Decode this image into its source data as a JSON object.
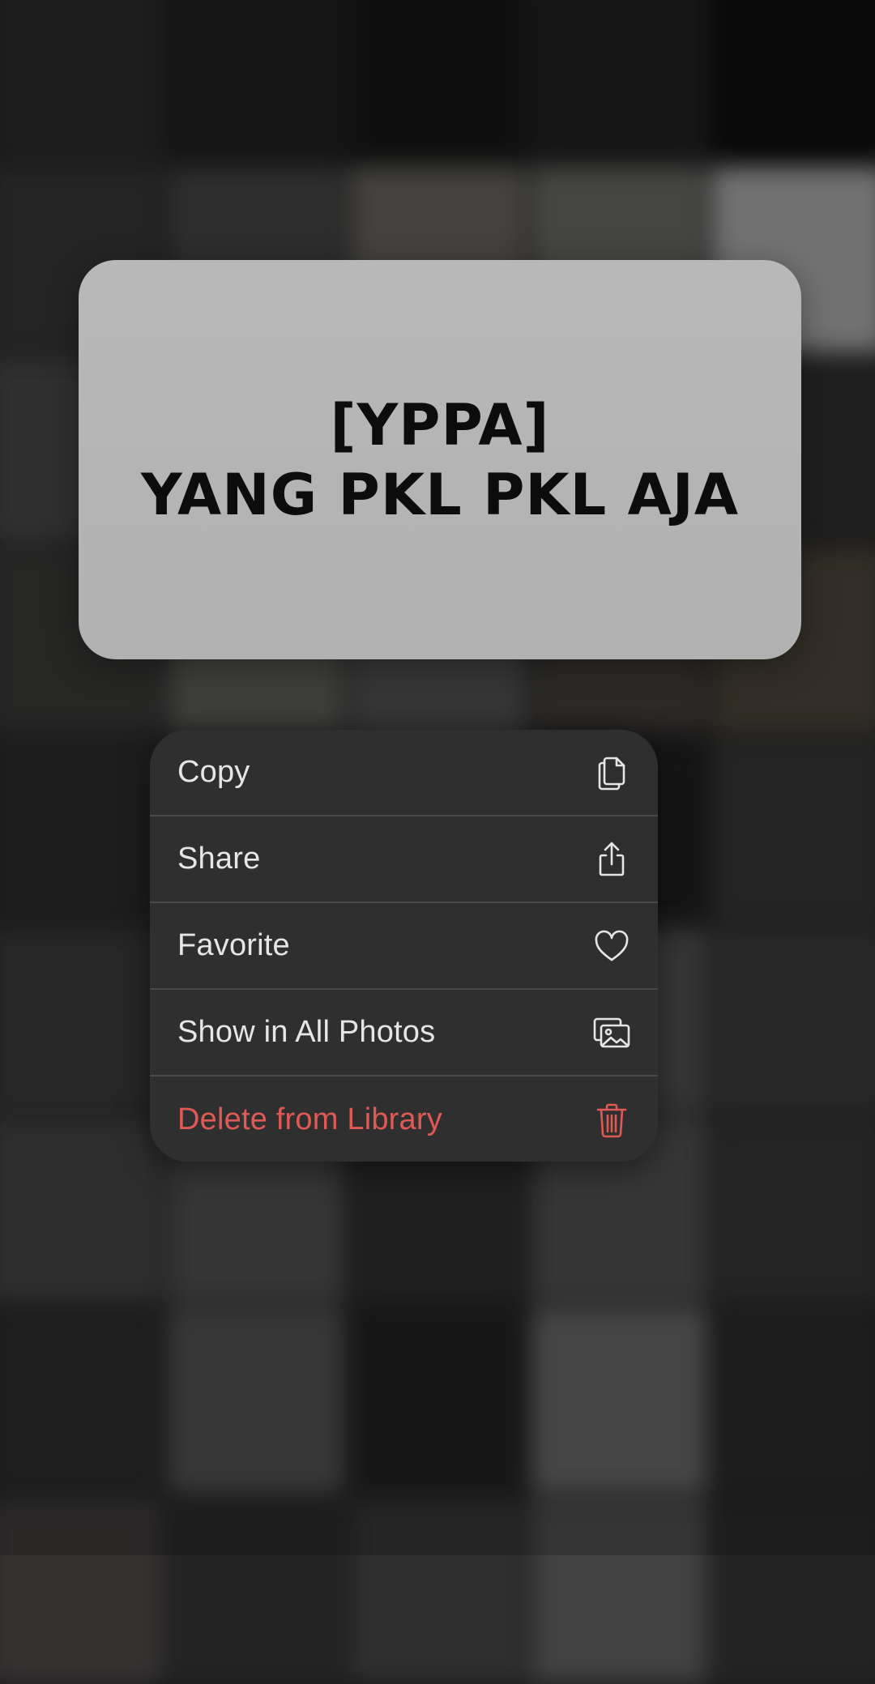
{
  "background": {
    "tiles": [
      "#3a3a3a",
      "#2a2a2a",
      "#1f1f1f",
      "#2c2c2c",
      "#111111",
      "#4a4a4a",
      "#5a5a5a",
      "#8b8374",
      "#8a8a80",
      "#e0e0e0",
      "#5e5e5e",
      "#6a5e55",
      "#7a7a7a",
      "#5a5a5a",
      "#3e3e3e",
      "#4a4f48",
      "#7b7b70",
      "#6b6b6b",
      "#5b5148",
      "#6b5a3a",
      "#3a3a3a",
      "#4a5a4a",
      "#6a6a6a",
      "#2a2a2a",
      "#4a4a4a",
      "#4e4e4e",
      "#3d3d3d",
      "#555555",
      "#6a6a6a",
      "#505050",
      "#5a5a5a",
      "#6a6a6a",
      "#3f3f3f",
      "#6b6b6b",
      "#4a4a4a",
      "#3c3c3c",
      "#6e6e6e",
      "#2e2e2e",
      "#8a8a8a",
      "#3a3a3a",
      "#5b4e4e",
      "#3a3a3a",
      "#4b4b4b",
      "#6a6a6a",
      "#3a3a3a"
    ]
  },
  "preview": {
    "line1": "[YPPA]",
    "line2": "YANG PKL PKL AJA"
  },
  "menu": {
    "items": [
      {
        "label": "Copy",
        "icon": "copy-icon"
      },
      {
        "label": "Share",
        "icon": "share-icon"
      },
      {
        "label": "Favorite",
        "icon": "heart-icon"
      },
      {
        "label": "Show in All Photos",
        "icon": "photos-icon"
      },
      {
        "label": "Delete from Library",
        "icon": "trash-icon"
      }
    ]
  },
  "colors": {
    "menu_text": "#e6e6e6",
    "destructive": "#e05a55"
  }
}
